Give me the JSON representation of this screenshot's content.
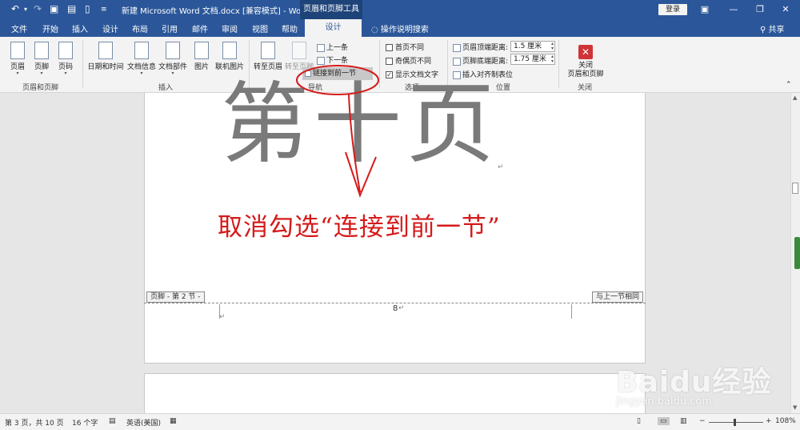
{
  "titlebar": {
    "undo_icon": "undo-icon",
    "redo_icon": "redo-icon",
    "title": "新建 Microsoft Word 文档.docx [兼容模式]  -  Word",
    "context_tab": "页眉和页脚工具",
    "login_label": "登录"
  },
  "tabs": {
    "items": [
      "文件",
      "开始",
      "插入",
      "设计",
      "布局",
      "引用",
      "邮件",
      "审阅",
      "视图",
      "帮助"
    ],
    "active": "设计",
    "tellme": "操作说明搜索",
    "share": "共享"
  },
  "ribbon": {
    "groups": {
      "header_footer": {
        "label": "页眉和页脚",
        "header": "页眉",
        "footer": "页脚",
        "page_number": "页码"
      },
      "insert": {
        "label": "插入",
        "date_time": "日期和时间",
        "doc_info": "文档信息",
        "doc_parts": "文档部件",
        "picture": "图片",
        "online_picture": "联机图片"
      },
      "navigation": {
        "label": "导航",
        "goto_header": "转至页眉",
        "goto_footer": "转至页脚",
        "previous": "上一条",
        "next": "下一条",
        "link_previous": "链接到前一节"
      },
      "options": {
        "label": "选项",
        "different_first": "首页不同",
        "different_odd_even": "奇偶页不同",
        "show_doc_text": "显示文档文字",
        "show_doc_text_checked": true
      },
      "position": {
        "label": "位置",
        "header_from_top": "页眉顶端距离:",
        "header_from_top_value": "1.5 厘米",
        "footer_from_bottom": "页脚底端距离:",
        "footer_from_bottom_value": "1.75 厘米",
        "insert_align_tab": "插入对齐制表位"
      },
      "close": {
        "label": "关闭",
        "close_button": "关闭\n页眉和页脚"
      }
    }
  },
  "document": {
    "heading": "第十页",
    "annotation": "取消勾选“连接到前一节”",
    "footer_tab_left": "页脚 - 第 2 节 -",
    "footer_tab_right": "与上一节相同",
    "page_number": "8",
    "annotation_color": "#d51a1a"
  },
  "statusbar": {
    "page": "第 3 页，共 10 页",
    "words": "16 个字",
    "language": "英语(美国)",
    "zoom": "108%"
  },
  "watermark": {
    "logo": "Baidu经验",
    "url": "jingyan.baidu.com"
  },
  "colors": {
    "accent": "#2b579a",
    "context_tab": "#1e4379"
  }
}
